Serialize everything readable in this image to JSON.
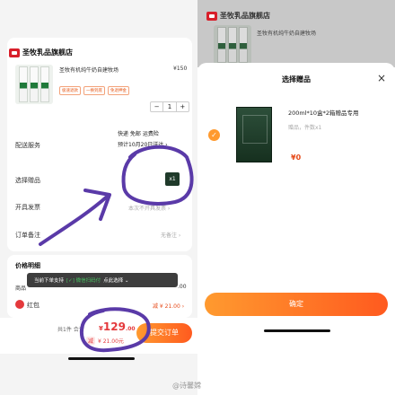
{
  "left": {
    "shop_name": "圣牧乳品旗舰店",
    "product": {
      "title": "圣牧有机纯牛奶自建牧场",
      "price": "¥150",
      "tags": [
        "极速退款",
        "一换到底",
        "免退押金"
      ],
      "quantity": "1",
      "minus": "−",
      "plus": "+"
    },
    "delivery": {
      "label": "配送服务",
      "line1": "快递 免邮 运费险",
      "line2": "预计10月20日送达 ›"
    },
    "gift": {
      "label": "选择赠品",
      "badge": "x1"
    },
    "invoice": {
      "label": "开具发票",
      "value": "本次不开具发票 ›"
    },
    "remark": {
      "label": "订单备注",
      "value": "无备注 ›"
    },
    "price_section": {
      "title": "价格明细",
      "shop_discount_label": "商品",
      "shop_discount_value": ".00"
    },
    "toast": {
      "prefix": "当前下单支持",
      "wechat": "[✓] 微信扫码付",
      "suffix": "点此选择 ⌄"
    },
    "redpacket": {
      "label": "红包",
      "value": "减 ¥ 21.00 ›"
    },
    "bottom": {
      "count": "共1件 合计",
      "total_yen": "¥",
      "total_int": "129",
      "total_dec": ".00",
      "saved_pill": "减",
      "saved": "¥ 21.00元",
      "submit": "提交订单"
    }
  },
  "right": {
    "bg_shop_name": "圣牧乳品旗舰店",
    "bg_title": "圣牧有机纯牛奶自建牧场",
    "sheet_title": "选择赠品",
    "close": "×",
    "gift_name": "200ml*10盒*2箱赠品专用",
    "gift_sub": "赠品，件数x1",
    "gift_price": "¥0",
    "confirm": "确定"
  },
  "watermark": "@诗馨嫦",
  "colors": {
    "accent_orange": "#ff7a22",
    "price_red": "#e4393c",
    "scribble_purple": "#5a3aa8"
  }
}
